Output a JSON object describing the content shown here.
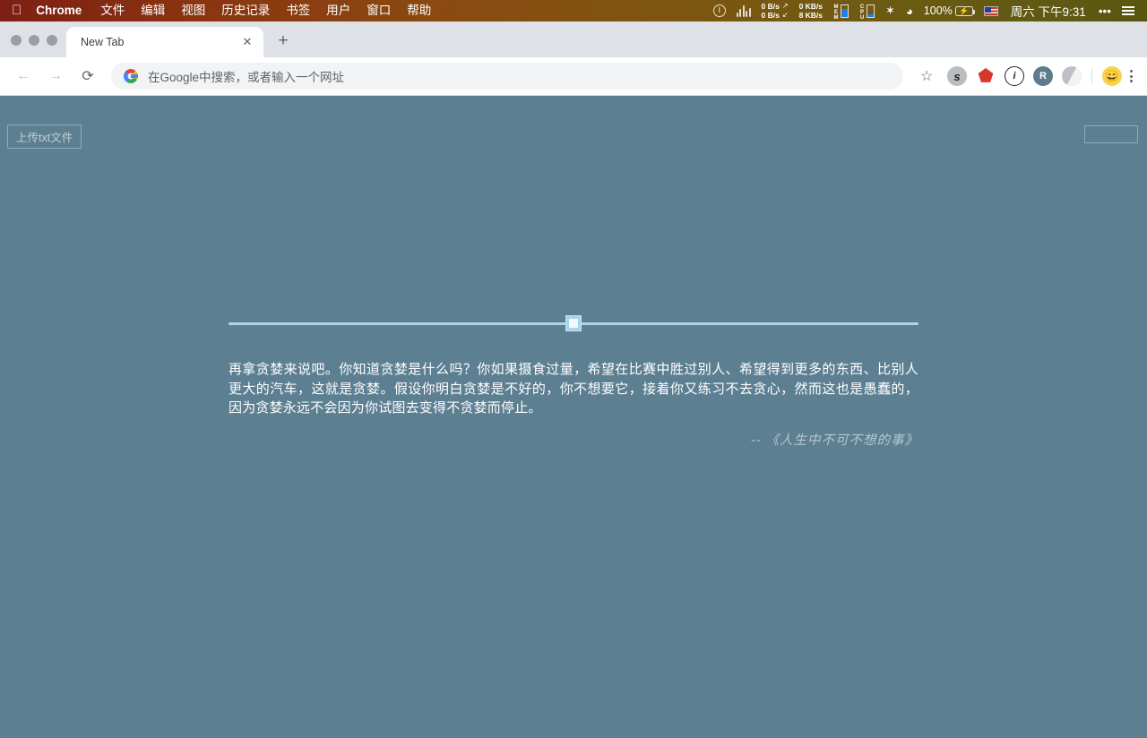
{
  "menubar": {
    "apple_icon": "apple-logo",
    "app_name": "Chrome",
    "menus": [
      "文件",
      "编辑",
      "视图",
      "历史记录",
      "书签",
      "用户",
      "窗口",
      "帮助"
    ],
    "status": {
      "power_icon": "power-icon",
      "sound_icon": "sound-bars-icon",
      "net_up": "0 B/s",
      "net_down": "0 B/s",
      "net_up_arrow": "↗",
      "net_down_arrow": "↙",
      "disk_up": "0 KB/s",
      "disk_down": "8 KB/s",
      "mem_label": "MEM",
      "cpu_label": "CPU",
      "bluetooth_icon": "✳",
      "wifi_icon": "wifi-icon",
      "battery_percent": "100%",
      "battery_charging": "⚡",
      "input_source": "us-flag",
      "clock": "周六 下午9:31",
      "more_icon": "•••",
      "control_center_icon": "control-center-icon"
    }
  },
  "browser": {
    "traffic_lights": [
      "close",
      "minimize",
      "zoom"
    ],
    "tab": {
      "title": "New Tab",
      "close_icon": "✕"
    },
    "new_tab_icon": "+",
    "nav": {
      "back_icon": "←",
      "forward_icon": "→",
      "reload_icon": "⟳"
    },
    "omnibox": {
      "placeholder": "在Google中搜索，或者输入一个网址",
      "value": "",
      "logo": "google-g-logo"
    },
    "bookmark_icon": "☆",
    "extensions": [
      {
        "name": "extension-s",
        "glyph": "s"
      },
      {
        "name": "extension-shield",
        "glyph": "⬟"
      },
      {
        "name": "extension-info",
        "glyph": "i"
      },
      {
        "name": "extension-r",
        "glyph": "R"
      },
      {
        "name": "extension-half-circle",
        "glyph": ""
      }
    ],
    "avatar_icon": "😄",
    "menu_icon": "kebab-menu"
  },
  "page": {
    "upload_button": "上传txt文件",
    "corner_box": "",
    "slider": {
      "value": 50,
      "min": 0,
      "max": 100
    },
    "quote": "再拿贪婪来说吧。你知道贪婪是什么吗？你如果摄食过量，希望在比赛中胜过别人、希望得到更多的东西、比别人更大的汽车，这就是贪婪。假设你明白贪婪是不好的，你不想要它，接着你又练习不去贪心，然而这也是愚蠢的，因为贪婪永远不会因为你试图去变得不贪婪而停止。",
    "attribution": "--  《人生中不可不想的事》",
    "background_color": "#5d7f92",
    "text_color": "#ffffff"
  }
}
